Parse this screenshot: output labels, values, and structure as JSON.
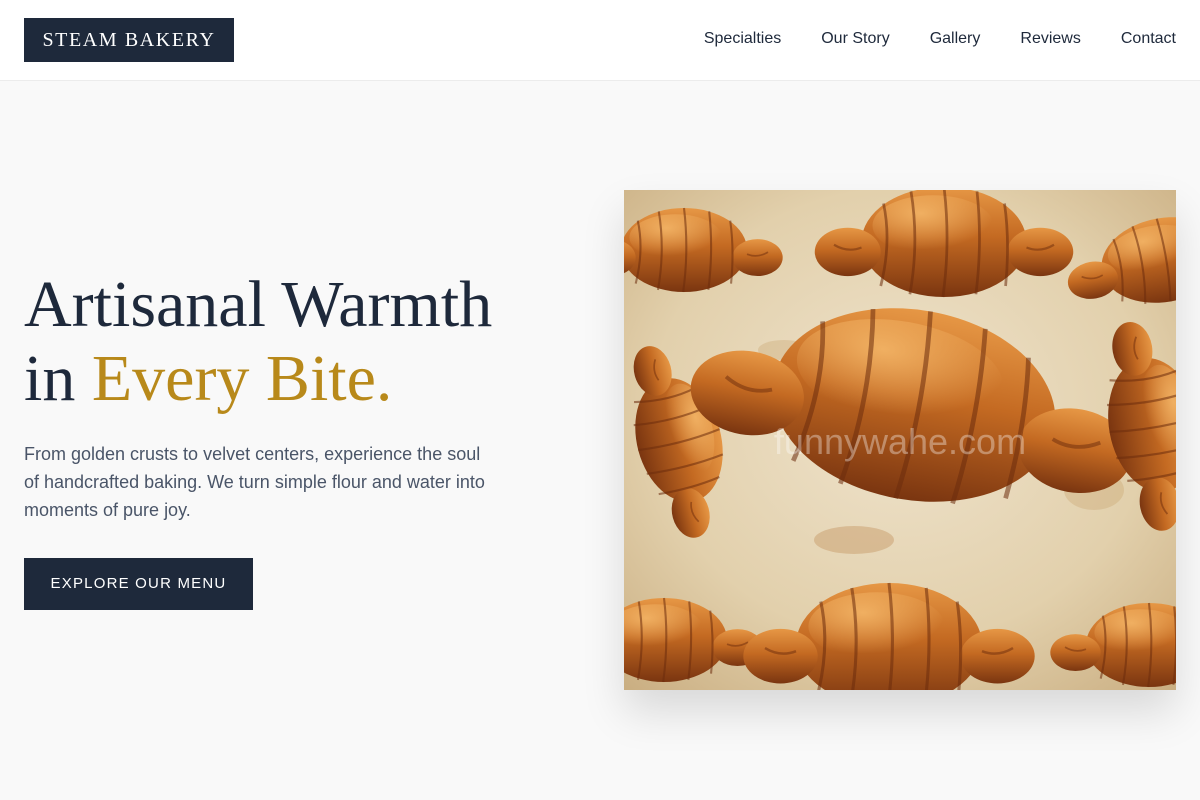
{
  "header": {
    "logo": "STEAM BAKERY",
    "nav": [
      {
        "label": "Specialties"
      },
      {
        "label": "Our Story"
      },
      {
        "label": "Gallery"
      },
      {
        "label": "Reviews"
      },
      {
        "label": "Contact"
      }
    ]
  },
  "hero": {
    "headline_line1": "Artisanal Warmth",
    "headline_in": "in ",
    "headline_accent": "Every Bite.",
    "intro": "From golden crusts to velvet centers, experience the soul of handcrafted baking. We turn simple flour and water into moments of pure joy.",
    "cta_label": "EXPLORE OUR MENU",
    "image": {
      "subject": "croissants on parchment",
      "watermark": "funnywahe.com"
    }
  },
  "colors": {
    "navy": "#1e293b",
    "gold": "#b8891a",
    "body_text": "#4a5568",
    "background": "#f9f9f9"
  }
}
